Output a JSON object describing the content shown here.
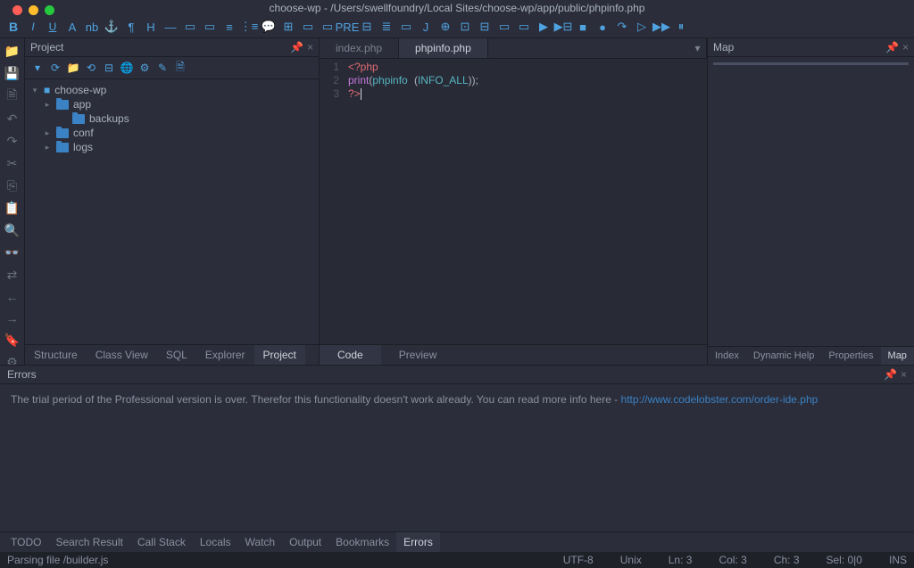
{
  "window": {
    "title": "choose-wp - /Users/swellfoundry/Local Sites/choose-wp/app/public/phpinfo.php"
  },
  "left_panel": {
    "title": "Project"
  },
  "project_tree": {
    "root": "choose-wp",
    "children": [
      "app",
      "backups",
      "conf",
      "logs"
    ]
  },
  "editor": {
    "tabs": [
      "index.php",
      "phpinfo.php"
    ],
    "active_tab": "phpinfo.php",
    "lines": [
      "1",
      "2",
      "3"
    ],
    "code": {
      "l1_open": "<?php",
      "l2_kw": "print",
      "l2_fn": "phpinfo",
      "l2_arg": "INFO_ALL",
      "l3_close": "?>"
    },
    "bottom_tabs": [
      "Code",
      "Preview"
    ],
    "active_bottom": "Code"
  },
  "map_panel": {
    "title": "Map"
  },
  "right_tabs": [
    "Index",
    "Dynamic Help",
    "Properties",
    "Map"
  ],
  "right_active": "Map",
  "left_tabs": [
    "Structure",
    "Class View",
    "SQL",
    "Explorer",
    "Project"
  ],
  "left_active": "Project",
  "errors": {
    "title": "Errors",
    "message_prefix": "The trial period of the Professional version is over. Therefor this functionality doesn't work already. You can read more info here - ",
    "link_text": "http://www.codelobster.com/order-ide.php"
  },
  "bottom_tabs": [
    "TODO",
    "Search Result",
    "Call Stack",
    "Locals",
    "Watch",
    "Output",
    "Bookmarks",
    "Errors"
  ],
  "bottom_active": "Errors",
  "status": {
    "parsing": "Parsing file /builder.js",
    "encoding": "UTF-8",
    "eol": "Unix",
    "line": "Ln: 3",
    "col": "Col: 3",
    "chr": "Ch: 3",
    "sel": "Sel: 0|0",
    "mode": "INS"
  }
}
